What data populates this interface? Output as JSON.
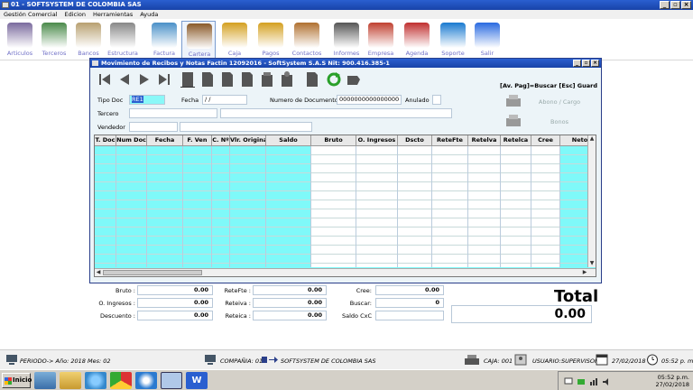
{
  "app": {
    "title": "01 - SOFTSYSTEM DE COLOMBIA SAS"
  },
  "menu": [
    "Gestión Comercial",
    "Edicion",
    "Herramientas",
    "Ayuda"
  ],
  "toolbar": [
    {
      "label": "Articulos",
      "icon": "articles-icon",
      "color": "#7a6a9e"
    },
    {
      "label": "Terceros",
      "icon": "people-icon",
      "color": "#4a8a4a"
    },
    {
      "label": "Bancos",
      "icon": "bank-icon",
      "color": "#b8a070"
    },
    {
      "label": "Estructura",
      "icon": "tools-icon",
      "color": "#888888"
    },
    {
      "label": "Factura",
      "icon": "store-icon",
      "color": "#4a90c8"
    },
    {
      "label": "Cartera",
      "icon": "briefcase-icon",
      "color": "#8a5a2a"
    },
    {
      "label": "Caja",
      "icon": "coins-icon",
      "color": "#d4a020"
    },
    {
      "label": "Pagos",
      "icon": "coins-icon",
      "color": "#d4a020"
    },
    {
      "label": "Contactos",
      "icon": "address-book-icon",
      "color": "#b07030"
    },
    {
      "label": "Informes",
      "icon": "printer-icon",
      "color": "#555555"
    },
    {
      "label": "Empresa",
      "icon": "house-icon",
      "color": "#c04030"
    },
    {
      "label": "Agenda",
      "icon": "calendar-icon",
      "color": "#c03030"
    },
    {
      "label": "Soporte",
      "icon": "teamviewer-icon",
      "color": "#1a7ad0"
    },
    {
      "label": "Salir",
      "icon": "exit-icon",
      "color": "#2a6ae0"
    }
  ],
  "form": {
    "title": "Movimiento de Recibos y Notas Factin 12092016 - SoftSystem S.A.S Nit: 900.416.385-1",
    "hint": "[Av. Pag]=Buscar   [Esc] Guard",
    "tipo_doc_label": "Tipo Doc",
    "tipo_doc_value": "RE1",
    "fecha_label": "Fecha",
    "fecha_value": " / /",
    "numero_label": "Numero de Documento",
    "numero_value": "0000000000000000",
    "anulado_label": "Anulado",
    "tercero_label": "Tercero",
    "vendedor_label": "Vendedor",
    "abono_label": "Abono / Cargo",
    "bonos_label": "Bonos"
  },
  "grid": {
    "columns": [
      "T. Doc",
      "Num Doc",
      "Fecha",
      "F. Ven",
      "C. Nº",
      "Vlr. Original",
      "Saldo",
      "Bruto",
      "O. Ingresos",
      "Dscto",
      "ReteFte",
      "Retelva",
      "Retelca",
      "Cree",
      "Neto"
    ]
  },
  "totals": {
    "bruto_label": "Bruto :",
    "bruto": "0.00",
    "oingresos_label": "O. Ingresos :",
    "oingresos": "0.00",
    "descuento_label": "Descuento :",
    "descuento": "0.00",
    "retefte_label": "ReteFte :",
    "retefte": "0.00",
    "reteiva_label": "Reteiva :",
    "reteiva": "0.00",
    "reteica_label": "Reteica :",
    "reteica": "0.00",
    "cree_label": "Cree:",
    "cree": "0.00",
    "buscar_label": "Buscar:",
    "buscar": "0",
    "saldocxc_label": "Saldo CxC",
    "saldocxc": "",
    "total_label": "Total",
    "total": "0.00"
  },
  "status": {
    "periodo": "PERIODO-> Año: 2018  Mes: 02",
    "compania": "COMPAÑIA: 01",
    "empresa": "SOFTSYSTEM DE COLOMBIA SAS",
    "caja": "CAJA: 001",
    "usuario": "USUARIO:SUPERVISOR",
    "fecha": "27/02/2018",
    "hora": "05:52 p. m."
  },
  "taskbar": {
    "start": "Inicio",
    "clock_time": "05:52 p.m.",
    "clock_date": "27/02/2018"
  }
}
